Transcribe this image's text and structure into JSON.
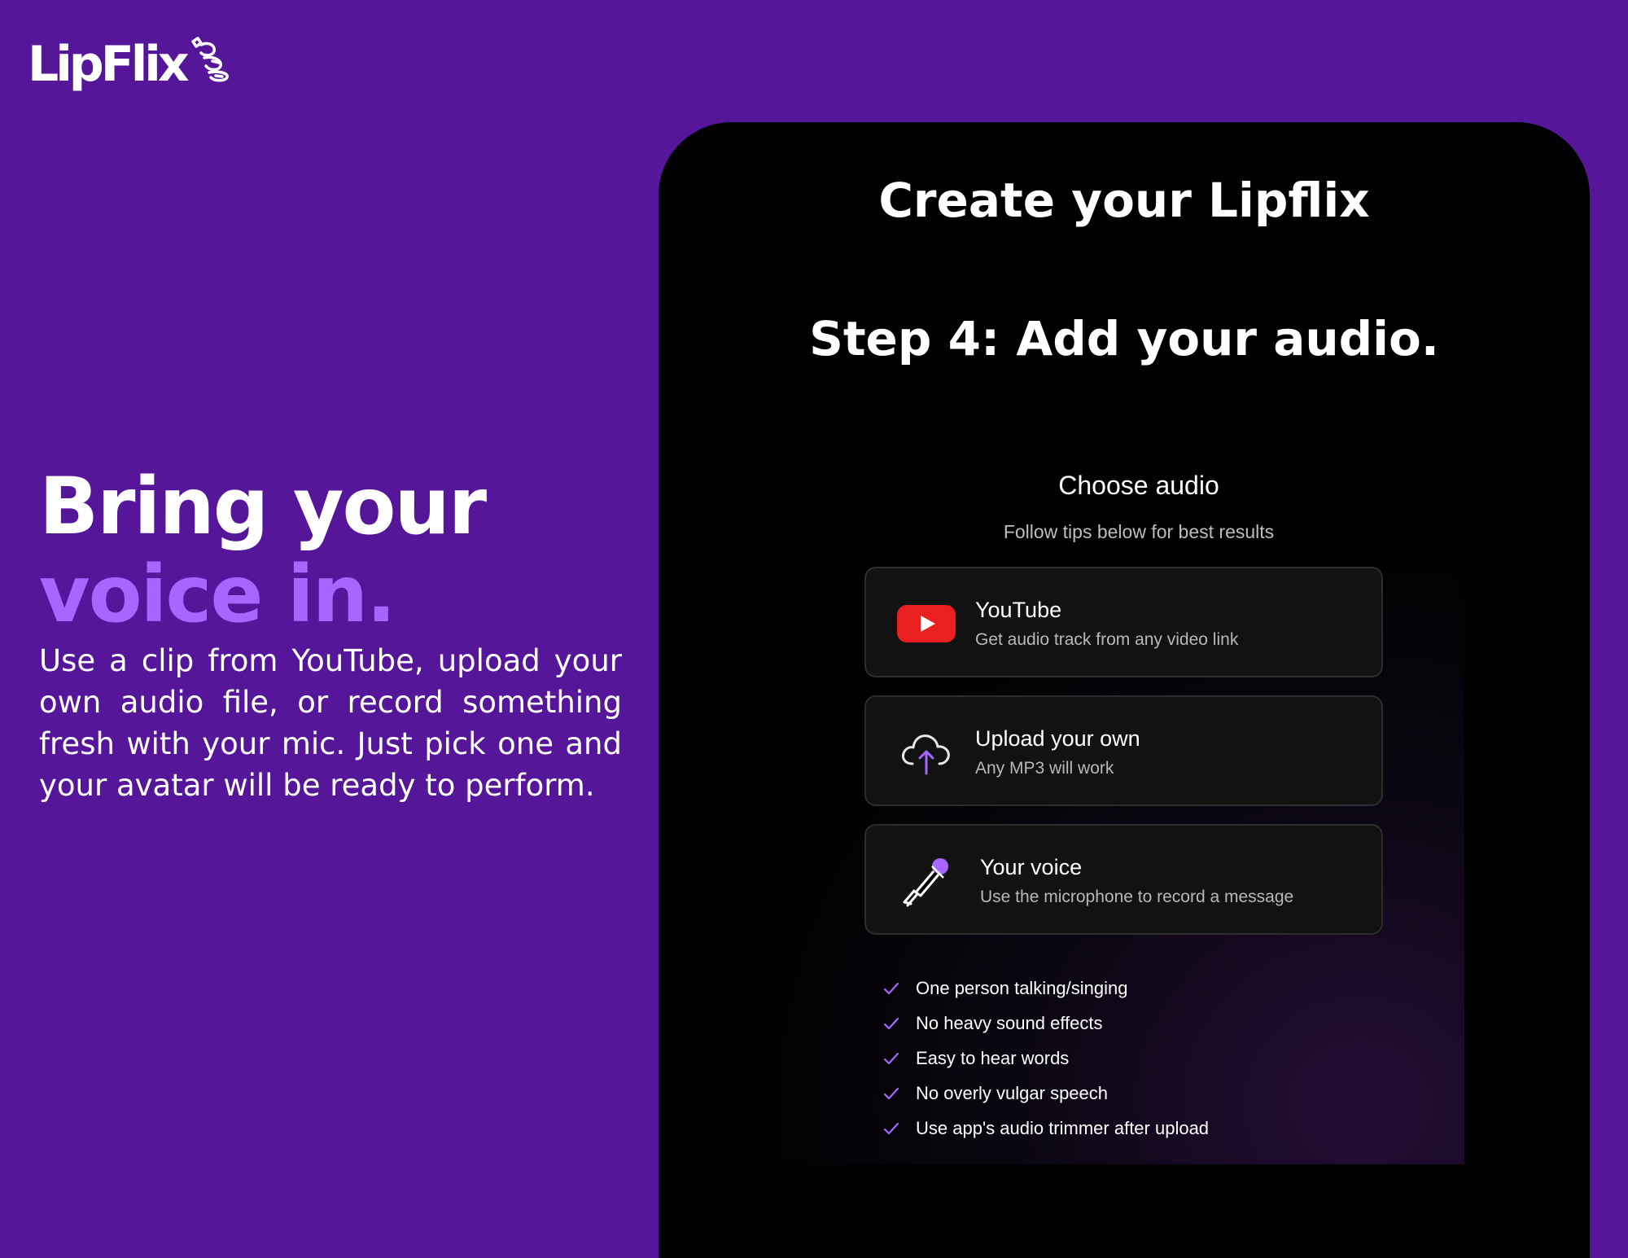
{
  "brand": {
    "logo_text": "LipFlix",
    "accent_color": "#a766ff",
    "background_color": "#55169a"
  },
  "hero": {
    "title_line1": "Bring your",
    "title_line2": "voice in.",
    "body": "Use a clip from YouTube, upload your own audio file, or record something fresh with your mic. Just pick one and your avatar will be ready to perform."
  },
  "panel": {
    "title": "Create your Lipflix",
    "step": "Step 4: Add your audio."
  },
  "choose": {
    "title": "Choose audio",
    "subtitle": "Follow tips below for best results"
  },
  "options": [
    {
      "icon": "youtube-icon",
      "title": "YouTube",
      "desc": "Get audio track from any video link"
    },
    {
      "icon": "cloud-upload-icon",
      "title": "Upload your own",
      "desc": "Any MP3 will work"
    },
    {
      "icon": "microphone-icon",
      "title": "Your voice",
      "desc": "Use the microphone to record a message"
    }
  ],
  "tips": [
    "One person talking/singing",
    "No heavy sound effects",
    "Easy to hear words",
    "No overly vulgar speech",
    "Use app's audio trimmer after upload"
  ]
}
